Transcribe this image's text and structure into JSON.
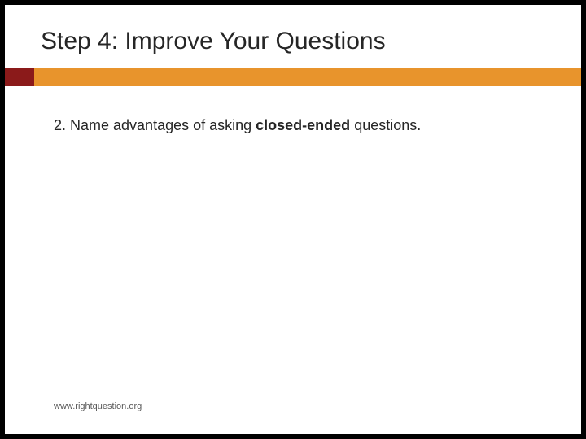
{
  "slide": {
    "title": "Step 4: Improve Your Questions",
    "body": {
      "prefix": "2. Name advantages of asking ",
      "bold": "closed-ended",
      "suffix": " questions."
    },
    "footer": "www.rightquestion.org"
  }
}
